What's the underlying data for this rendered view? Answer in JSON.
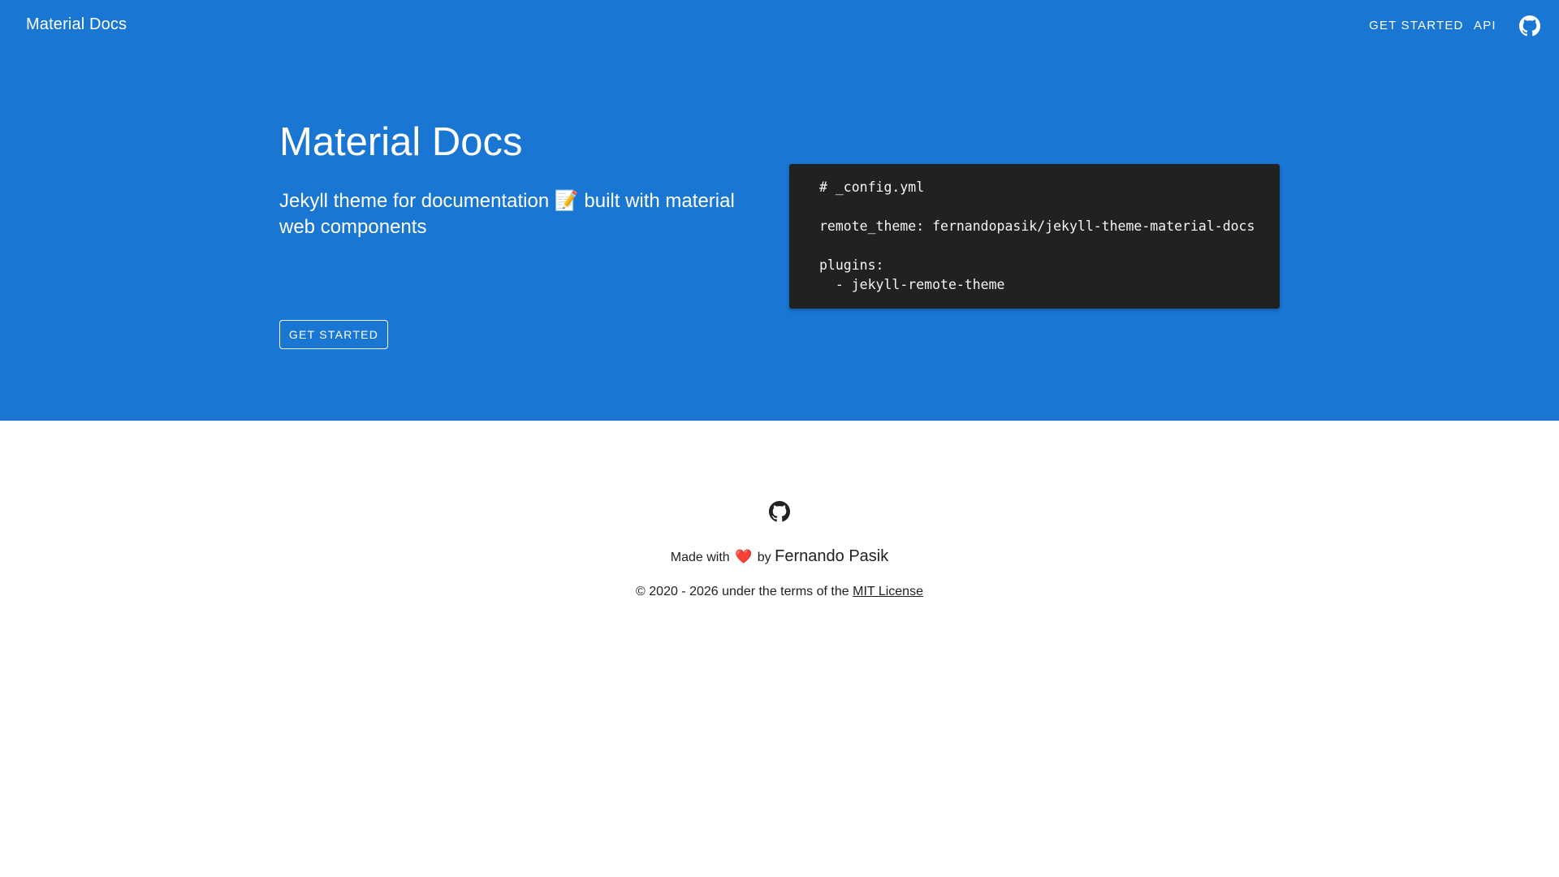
{
  "topbar": {
    "brand": "Material Docs",
    "nav": [
      {
        "label": "GET STARTED"
      },
      {
        "label": "API"
      }
    ],
    "github_icon": "github-icon"
  },
  "hero": {
    "title": "Material Docs",
    "subtitle": "Jekyll theme for documentation 📝 built with material web components",
    "button_label": "GET STARTED",
    "background": "#1976d2"
  },
  "code": {
    "lines": [
      "# _config.yml",
      "",
      "remote_theme: fernandopasik/jekyll-theme-material-docs",
      "",
      "plugins:",
      "  - jekyll-remote-theme"
    ],
    "background": "#212121"
  },
  "footer": {
    "github_icon": "github-icon",
    "made_with": "Made with",
    "heart": "❤️",
    "by": "by",
    "author": "Fernando Pasik",
    "copyright_prefix": "© 2020 - 2026 under the terms of the",
    "license": "MIT License"
  }
}
